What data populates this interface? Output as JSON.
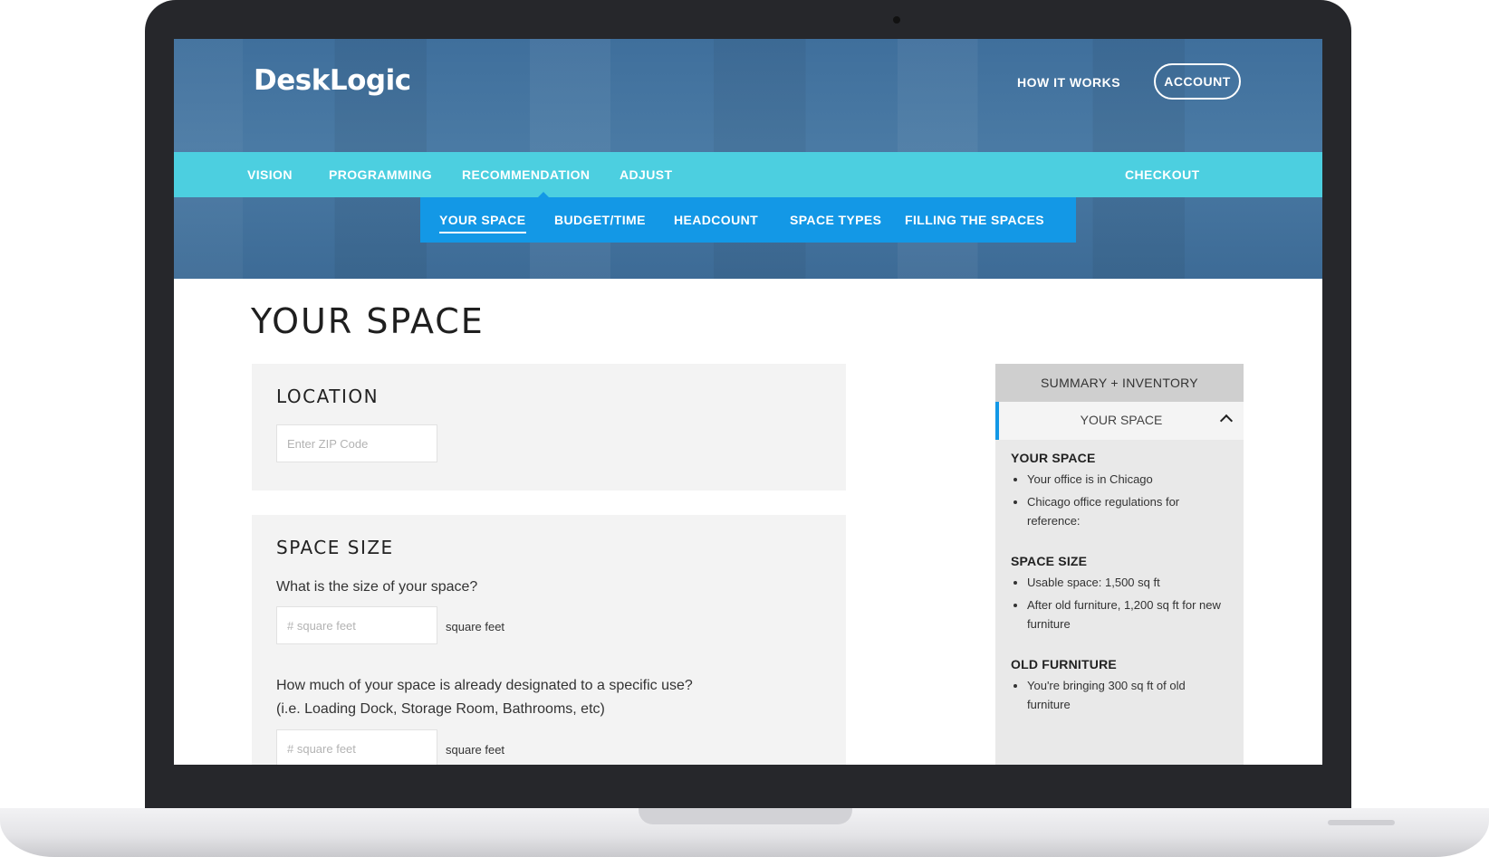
{
  "brand": {
    "logo": "DeskLogic"
  },
  "top_nav": {
    "how_it_works": "HOW IT WORKS",
    "account": "ACCOUNT"
  },
  "main_nav": {
    "items": [
      "VISION",
      "PROGRAMMING",
      "RECOMMENDATION",
      "ADJUST"
    ],
    "checkout": "CHECKOUT",
    "active": "RECOMMENDATION"
  },
  "sub_nav": {
    "items": [
      "YOUR SPACE",
      "BUDGET/TIME",
      "HEADCOUNT",
      "SPACE TYPES",
      "FILLING THE SPACES"
    ],
    "active": "YOUR SPACE"
  },
  "page": {
    "title": "YOUR SPACE"
  },
  "location": {
    "title": "LOCATION",
    "zip_placeholder": "Enter ZIP Code"
  },
  "space_size": {
    "title": "SPACE SIZE",
    "q1": "What is the size of your space?",
    "q1_placeholder": "# square feet",
    "q1_unit": "square feet",
    "q2_line1": "How much of your space is already designated to a specific use?",
    "q2_line2": "(i.e. Loading Dock, Storage Room, Bathrooms, etc)",
    "q2_placeholder": "# square feet",
    "q2_unit": "square feet"
  },
  "sidebar": {
    "header": "SUMMARY + INVENTORY",
    "tab": "YOUR SPACE",
    "sections": [
      {
        "heading": "YOUR SPACE",
        "items": [
          "Your office is in Chicago",
          "Chicago office regulations for reference:"
        ]
      },
      {
        "heading": "SPACE SIZE",
        "items": [
          "Usable space: 1,500 sq ft",
          "After old furniture, 1,200 sq ft for new furniture"
        ]
      },
      {
        "heading": "OLD FURNITURE",
        "items": [
          "You're bringing 300 sq ft of old furniture"
        ]
      }
    ]
  },
  "colors": {
    "nav": "#4ccfe0",
    "subnav": "#1398e6",
    "hero": "#4a7aa4",
    "frame": "#26272b"
  }
}
